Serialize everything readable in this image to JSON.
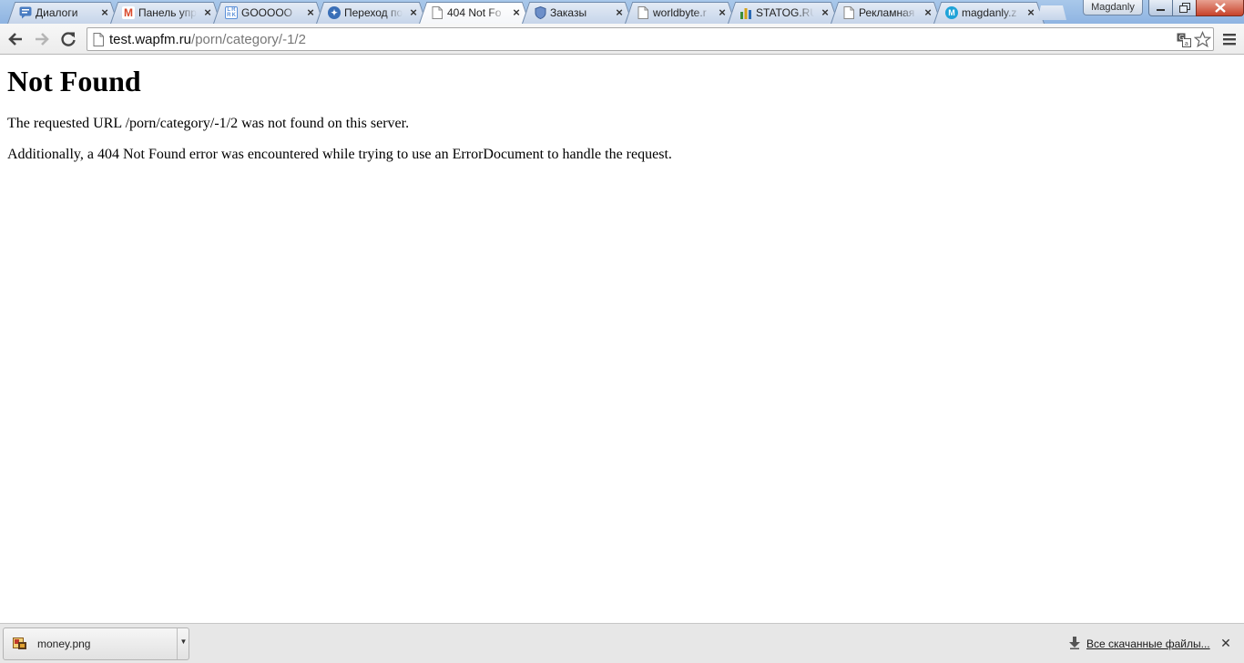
{
  "window": {
    "profile_name": "Magdanly",
    "minimize_icon": "minimize-icon",
    "maximize_icon": "restore-icon",
    "close_icon": "close-icon"
  },
  "tabs": [
    {
      "title": "Диалоги",
      "favicon": "chat-icon",
      "color": "#4a7cc1",
      "active": false
    },
    {
      "title": "Панель упр",
      "favicon": "brand-m-icon",
      "color": "#d9482b",
      "active": false
    },
    {
      "title": "GOOOOO",
      "favicon": "lrk-icon",
      "color": "#5a8fd8",
      "active": false
    },
    {
      "title": "Переход по",
      "favicon": "compass-icon",
      "color": "#3a6fb7",
      "active": false
    },
    {
      "title": "404 Not Fo",
      "favicon": "page-icon",
      "color": "#ffffff",
      "active": true
    },
    {
      "title": "Заказы",
      "favicon": "shield-icon",
      "color": "#6d8fc9",
      "active": false
    },
    {
      "title": "worldbyte.r",
      "favicon": "page-icon",
      "color": "#ffffff",
      "active": false
    },
    {
      "title": "STATOG.RU",
      "favicon": "bar-chart-icon",
      "color": "#3b8e3b",
      "active": false
    },
    {
      "title": "Рекламная",
      "favicon": "page-icon",
      "color": "#ffffff",
      "active": false
    },
    {
      "title": "magdanly.z",
      "favicon": "brand-m-round-icon",
      "color": "#1fa3d8",
      "active": false
    }
  ],
  "toolbar": {
    "url_host": "test.wapfm.ru",
    "url_path": "/porn/category/-1/2"
  },
  "page": {
    "heading": "Not Found",
    "p1": "The requested URL /porn/category/-1/2 was not found on this server.",
    "p2": "Additionally, a 404 Not Found error was encountered while trying to use an ErrorDocument to handle the request."
  },
  "downloads": {
    "file_name": "money.png",
    "all_downloads_label": "Все скачанные файлы..."
  }
}
